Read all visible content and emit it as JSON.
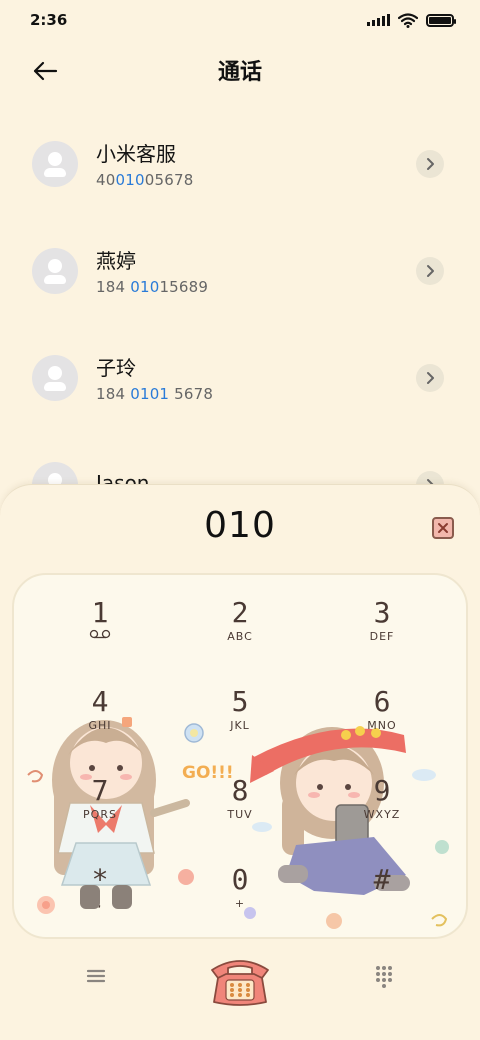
{
  "status_bar": {
    "time": "2:36"
  },
  "header": {
    "title": "通话"
  },
  "contacts": [
    {
      "name": "小米客服",
      "number_pre": "40",
      "number_match": "010",
      "number_post": "05678"
    },
    {
      "name": "燕婷",
      "number_pre": "184 ",
      "number_match": "010",
      "number_post": "15689"
    },
    {
      "name": "子玲",
      "number_pre": "184 ",
      "number_match": "0101",
      "number_post": " 5678"
    },
    {
      "name": "Jason",
      "number_pre": "",
      "number_match": "",
      "number_post": ""
    }
  ],
  "dialer": {
    "input_value": "010",
    "artwork_label": "GO!!!",
    "keys": [
      {
        "digit": "1",
        "letters": ""
      },
      {
        "digit": "2",
        "letters": "ABC"
      },
      {
        "digit": "3",
        "letters": "DEF"
      },
      {
        "digit": "4",
        "letters": "GHI"
      },
      {
        "digit": "5",
        "letters": "JKL"
      },
      {
        "digit": "6",
        "letters": "MNO"
      },
      {
        "digit": "7",
        "letters": "PQRS"
      },
      {
        "digit": "8",
        "letters": "TUV"
      },
      {
        "digit": "9",
        "letters": "WXYZ"
      },
      {
        "digit": "*",
        "letters": ","
      },
      {
        "digit": "0",
        "letters": "+"
      },
      {
        "digit": "#",
        "letters": ""
      }
    ]
  },
  "colors": {
    "background": "#fcf3e0",
    "match_highlight": "#2a7bd8",
    "call_button": "#f0857a"
  },
  "icons": {
    "back": "arrow-left-icon",
    "detail": "chevron-right-icon",
    "delete": "backspace-icon",
    "voicemail": "voicemail-icon",
    "menu": "menu-icon",
    "call": "phone-icon",
    "keypad_toggle": "keypad-grid-icon"
  }
}
